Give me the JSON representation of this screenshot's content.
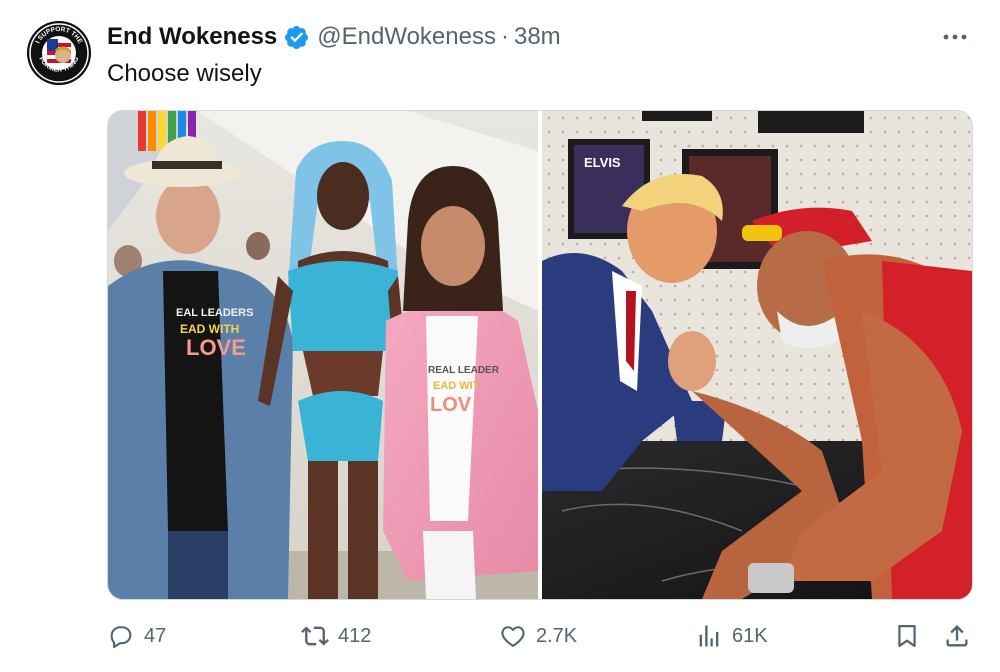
{
  "author": {
    "display_name": "End Wokeness",
    "handle": "@EndWokeness",
    "separator": "·",
    "time": "38m",
    "verified": true,
    "avatar_top_text": "I SUPPORT THE",
    "avatar_bottom_text": "FORMER THING"
  },
  "tweet": {
    "text": "Choose wisely"
  },
  "media": {
    "left_image": {
      "shirt_text_man": [
        "EAL LEADERS",
        "EAD WITH",
        "LOVE"
      ],
      "shirt_text_woman": [
        "REAL LEADER",
        "EAD WIT",
        "LOV"
      ]
    },
    "right_image": {
      "poster_text": "ELVIS"
    }
  },
  "actions": {
    "replies": "47",
    "reposts": "412",
    "likes": "2.7K",
    "views": "61K"
  },
  "colors": {
    "verified_blue": "#1d9bf0",
    "secondary_text": "#536471",
    "primary_text": "#0f1419"
  }
}
